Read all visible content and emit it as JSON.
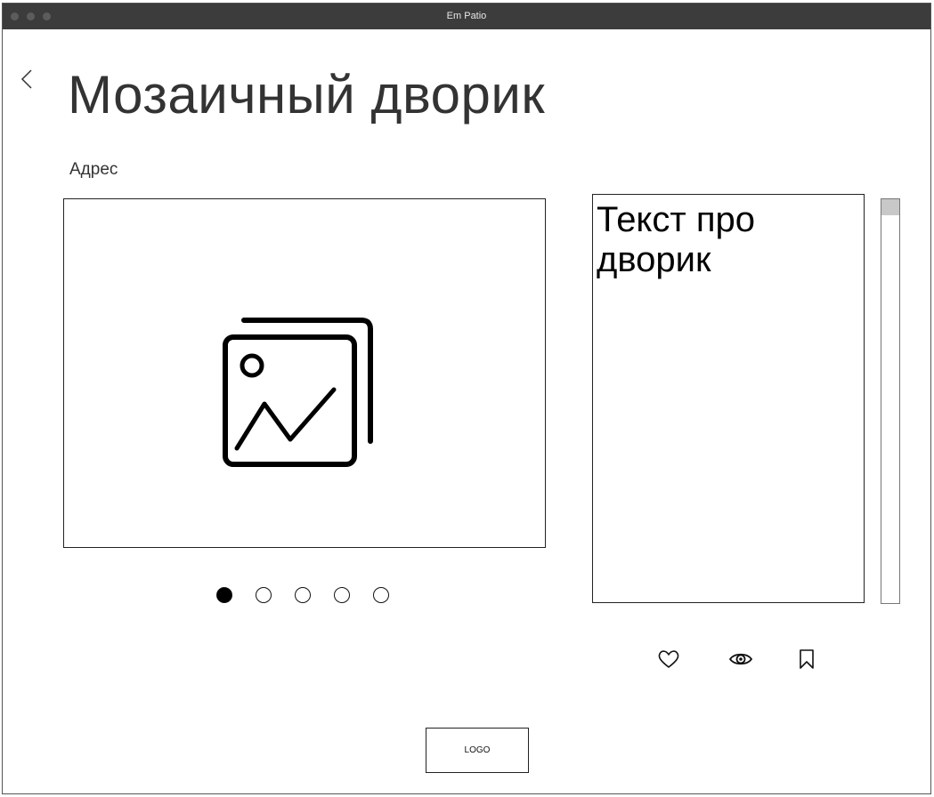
{
  "window": {
    "title": "Em Patio"
  },
  "page": {
    "title": "Мозаичный дворик",
    "address": "Адрес",
    "description": "Текст про дворик"
  },
  "carousel": {
    "slide_count": 5,
    "active_index": 0,
    "icon": "image-gallery-icon"
  },
  "actions": [
    {
      "icon": "heart-icon"
    },
    {
      "icon": "eye-icon"
    },
    {
      "icon": "bookmark-icon"
    }
  ],
  "footer": {
    "logo": "LOGO"
  },
  "nav": {
    "back_icon": "chevron-left-icon"
  }
}
